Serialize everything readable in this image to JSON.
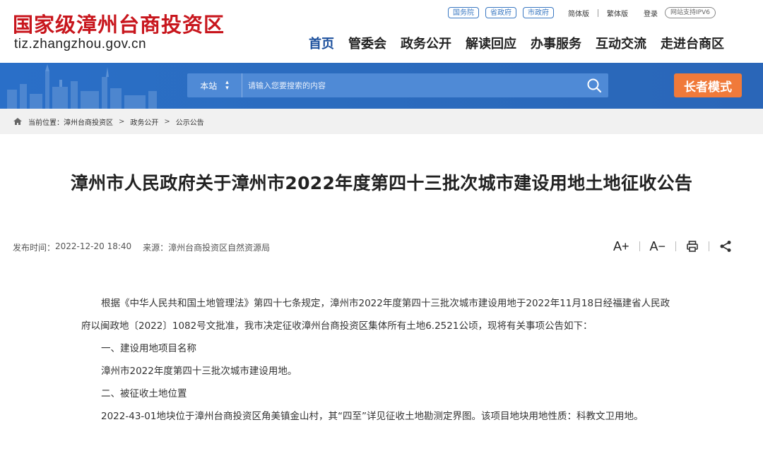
{
  "header": {
    "logo_title": "国家级漳州台商投资区",
    "logo_url": "tiz.zhangzhou.gov.cn",
    "top_links": [
      "国务院",
      "省政府",
      "市政府"
    ],
    "simplified": "简体版",
    "traditional": "繁体版",
    "login": "登录",
    "ipv6": "网站支持IPV6",
    "nav": [
      "首页",
      "管委会",
      "政务公开",
      "解读回应",
      "办事服务",
      "互动交流",
      "走进台商区"
    ]
  },
  "search": {
    "scope": "本站",
    "placeholder": "请输入您要搜索的内容"
  },
  "elder_mode": "长者模式",
  "breadcrumb": {
    "label": "当前位置：",
    "items": [
      "漳州台商投资区",
      "政务公开",
      "公示公告"
    ],
    "sep": ">"
  },
  "article": {
    "title": "漳州市人民政府关于漳州市2022年度第四十三批次城市建设用地土地征收公告",
    "publish_label": "发布时间：",
    "publish_time": "2022-12-20 18:40",
    "source_label": "来源：",
    "source": "漳州台商投资区自然资源局",
    "font_up": "A+",
    "font_down": "A−",
    "paragraphs": [
      "根据《中华人民共和国土地管理法》第四十七条规定，漳州市2022年度第四十三批次城市建设用地于2022年11月18日经福建省人民政府以闽政地〔2022〕1082号文批准，我市决定征收漳州台商投资区集体所有土地6.2521公顷，现将有关事项公告如下：",
      "一、建设用地项目名称",
      "漳州市2022年度第四十三批次城市建设用地。",
      "二、被征收土地位置",
      "2022-43-01地块位于漳州台商投资区角美镇金山村，其“四至”详见征收土地勘测定界图。该项目地块用地性质：科教文卫用地。"
    ]
  },
  "colors": {
    "brand_red": "#c8161d",
    "nav_active": "#1a4e9c",
    "banner_blue": "#2a6fc8",
    "elder_orange": "#f07a3a"
  },
  "icons": [
    "home-icon",
    "search-icon",
    "print-icon",
    "share-icon",
    "sort-arrows-icon"
  ]
}
